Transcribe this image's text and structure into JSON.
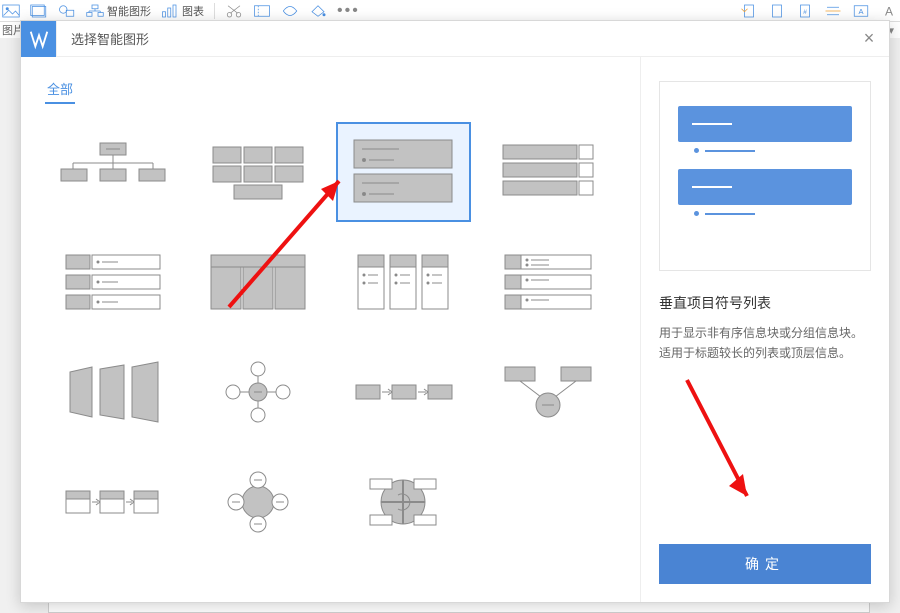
{
  "toolbar": {
    "smartart_label": "智能图形",
    "chart_label": "图表"
  },
  "underbar": {
    "left": "图片"
  },
  "modal": {
    "title": "选择智能图形",
    "tab_all": "全部",
    "close": "×"
  },
  "preview": {
    "title": "垂直项目符号列表",
    "desc": "用于显示非有序信息块或分组信息块。适用于标题较长的列表或顶层信息。"
  },
  "confirm": "确定"
}
